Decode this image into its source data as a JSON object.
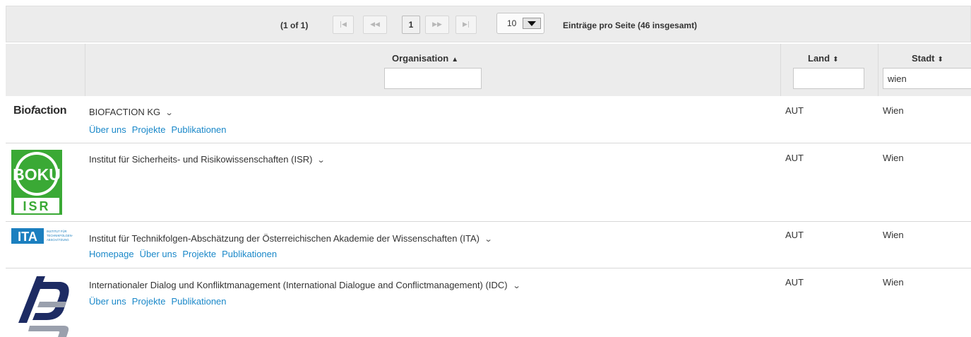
{
  "paginator": {
    "current": "(1 of 1)",
    "first_icon": "first-page-icon",
    "prev_icon": "prev-page-icon",
    "page": "1",
    "next_icon": "next-page-icon",
    "last_icon": "last-page-icon",
    "rows_per_page": "10",
    "info": "Einträge pro Seite (46 insgesamt)"
  },
  "columns": {
    "organisation": {
      "label": "Organisation",
      "sort": "asc",
      "filter": ""
    },
    "land": {
      "label": "Land",
      "sort": "none",
      "filter": ""
    },
    "stadt": {
      "label": "Stadt",
      "sort": "none",
      "filter": "wien"
    }
  },
  "rows": [
    {
      "logo_text": "Biofaction",
      "name": "BIOFACTION KG",
      "links": [
        "Über uns",
        "Projekte",
        "Publikationen"
      ],
      "land": "AUT",
      "stadt": "Wien"
    },
    {
      "logo_text": "BOKU ISR",
      "name": "Institut für Sicherheits- und Risikowissenschaften (ISR)",
      "links": [],
      "land": "AUT",
      "stadt": "Wien"
    },
    {
      "logo_text": "ITA INSTITUT FÜR TECHNIKFOLGEN-ABSCHÄTZUNG",
      "name": "Institut für Technikfolgen-Abschätzung der Österreichischen Akademie der Wissenschaften (ITA)",
      "links": [
        "Homepage",
        "Über uns",
        "Projekte",
        "Publikationen"
      ],
      "land": "AUT",
      "stadt": "Wien"
    },
    {
      "logo_text": "IDC",
      "name": "Internationaler Dialog und Konfliktmanagement (International Dialogue and Conflictmanagement) (IDC)",
      "links": [
        "Über uns",
        "Projekte",
        "Publikationen"
      ],
      "land": "AUT",
      "stadt": "Wien"
    }
  ],
  "colors": {
    "link": "#1a88c9",
    "header_bg": "#ececec",
    "boku_green": "#3aa935",
    "ita_blue": "#1b7fbf",
    "idc_navy": "#1d2b63"
  }
}
